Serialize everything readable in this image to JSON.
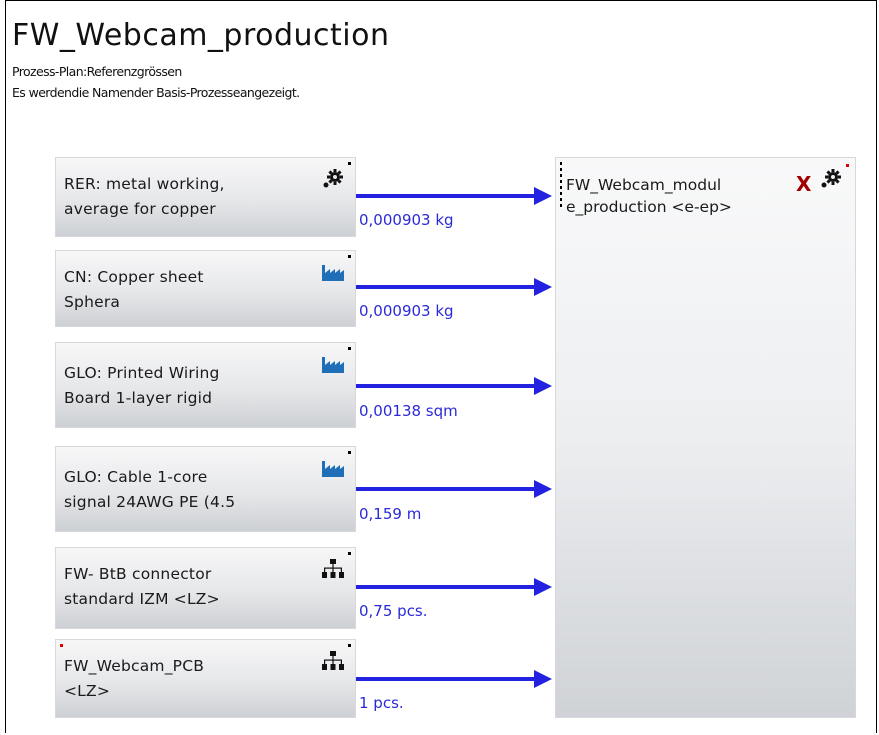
{
  "plan": {
    "title": "FW_Webcam_production",
    "subtitle1": "Prozess-Plan:Referenzgrössen",
    "subtitle2": "Es werdendie Namender Basis-Prozesseangezeigt."
  },
  "processes": [
    {
      "label": "RER: metal working,\naverage for copper",
      "icon": "gear-icon",
      "flow": "0,000903 kg"
    },
    {
      "label": "CN: Copper sheet\nSphera",
      "icon": "factory-icon",
      "flow": "0,000903 kg"
    },
    {
      "label": "GLO: Printed Wiring\nBoard 1-layer rigid",
      "icon": "factory-icon",
      "flow": "0,00138 sqm"
    },
    {
      "label": "GLO: Cable 1-core\nsignal 24AWG PE (4.5",
      "icon": "factory-icon",
      "flow": "0,159 m"
    },
    {
      "label": "FW- BtB connector\nstandard IZM <LZ>",
      "icon": "hierarchy-icon",
      "flow": "0,75 pcs."
    },
    {
      "label": "FW_Webcam_PCB\n<LZ>",
      "icon": "hierarchy-icon",
      "flow": "1 pcs."
    }
  ],
  "target": {
    "label": "FW_Webcam_modul\ne_production <e-ep>",
    "mark": "X",
    "icon": "gear-icon"
  },
  "colors": {
    "flow": "#2222e0",
    "flow_text": "#2a2ad8",
    "mark": "#a00000",
    "factory": "#1f6fb8"
  }
}
